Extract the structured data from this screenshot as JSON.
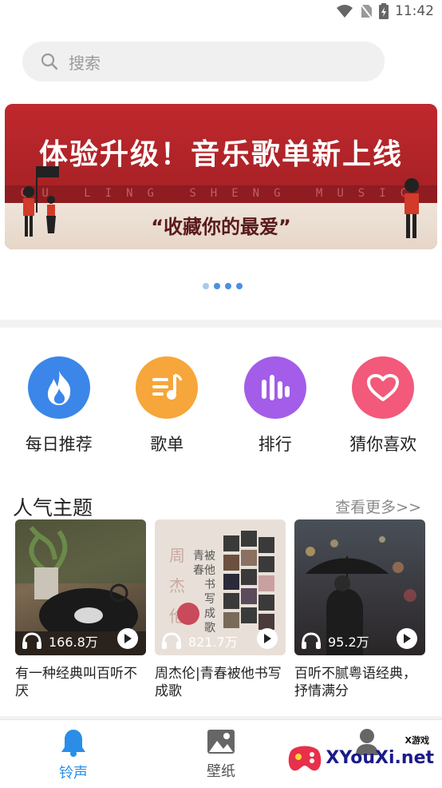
{
  "status": {
    "time": "11:42"
  },
  "search": {
    "placeholder": "搜索"
  },
  "banner": {
    "title": "体验升级！音乐歌单新上线",
    "subtitle": "QU LING SHENG MUSIC",
    "quote": "“收藏你的最爱”"
  },
  "carousel": {
    "dot_count": 4,
    "active_index": 0
  },
  "categories": [
    {
      "label": "每日推荐",
      "icon": "flame-icon",
      "color": "#3b86e8"
    },
    {
      "label": "歌单",
      "icon": "playlist-icon",
      "color": "#f6a63a"
    },
    {
      "label": "排行",
      "icon": "chart-bars-icon",
      "color": "#a35de8"
    },
    {
      "label": "猜你喜欢",
      "icon": "heart-icon",
      "color": "#f2597a"
    }
  ],
  "section": {
    "title": "人气主题",
    "more": "查看更多>>"
  },
  "cards": [
    {
      "plays": "166.8万",
      "title": "有一种经典叫百听不厌"
    },
    {
      "plays": "821.7万",
      "title": "周杰伦|青春被他书写成歌"
    },
    {
      "plays": "95.2万",
      "title": "百听不腻粤语经典，抒情满分"
    }
  ],
  "nav": {
    "ringtone": "铃声",
    "wallpaper": "壁纸"
  },
  "watermark": {
    "brand": "XYouXi.net",
    "tag": "X游戏"
  },
  "colors": {
    "accent": "#2a8ee8",
    "banner": "#b8262b"
  }
}
